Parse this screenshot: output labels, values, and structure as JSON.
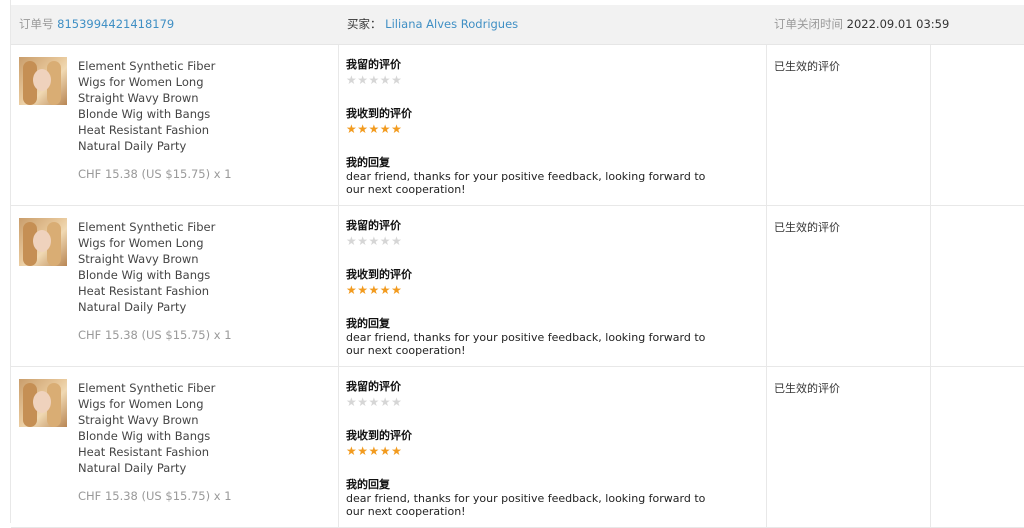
{
  "header": {
    "order_label": "订单号",
    "order_number": "8153994421418179",
    "buyer_label": "买家：",
    "buyer_name": "Liliana Alves Rodrigues",
    "close_time_label": "订单关闭时间",
    "close_time": "2022.09.01 03:59"
  },
  "rows": [
    {
      "title": "Element Synthetic Fiber Wigs for Women Long Straight Wavy Brown Blonde Wig with Bangs Heat Resistant Fashion Natural Daily Party",
      "price": "CHF 15.38 (US $15.75) x 1",
      "my_review_label": "我留的评价",
      "my_review_stars": 0,
      "received_review_label": "我收到的评价",
      "received_review_stars": 5,
      "reply_label": "我的回复",
      "reply_text": "dear friend, thanks for your positive feedback, looking forward to our next cooperation!",
      "status": "已生效的评价"
    },
    {
      "title": "Element Synthetic Fiber Wigs for Women Long Straight Wavy Brown Blonde Wig with Bangs Heat Resistant Fashion Natural Daily Party",
      "price": "CHF 15.38 (US $15.75) x 1",
      "my_review_label": "我留的评价",
      "my_review_stars": 0,
      "received_review_label": "我收到的评价",
      "received_review_stars": 5,
      "reply_label": "我的回复",
      "reply_text": "dear friend, thanks for your positive feedback, looking forward to our next cooperation!",
      "status": "已生效的评价"
    },
    {
      "title": "Element Synthetic Fiber Wigs for Women Long Straight Wavy Brown Blonde Wig with Bangs Heat Resistant Fashion Natural Daily Party",
      "price": "CHF 15.38 (US $15.75) x 1",
      "my_review_label": "我留的评价",
      "my_review_stars": 0,
      "received_review_label": "我收到的评价",
      "received_review_stars": 5,
      "reply_label": "我的回复",
      "reply_text": "dear friend, thanks for your positive feedback, looking forward to our next cooperation!",
      "status": "已生效的评价"
    }
  ],
  "colors": {
    "link": "#3f8fc4",
    "star_filled": "#f29b1f",
    "star_empty": "#d6d6d6"
  }
}
